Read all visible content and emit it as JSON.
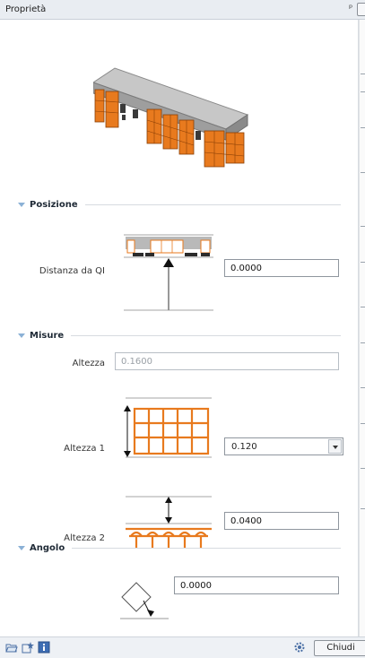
{
  "window": {
    "title": "Proprietà",
    "pin_glyph": "ᵖ"
  },
  "sections": {
    "posizione": {
      "label": "Posizione"
    },
    "misure": {
      "label": "Misure"
    },
    "angolo": {
      "label": "Angolo"
    }
  },
  "fields": {
    "distanza": {
      "label": "Distanza da QI",
      "value": "0.0000"
    },
    "altezza": {
      "label": "Altezza",
      "value": "0.1600"
    },
    "altezza1": {
      "label": "Altezza 1",
      "value": "0.120"
    },
    "altezza2": {
      "label": "Altezza 2",
      "value": "0.0400"
    },
    "angolo": {
      "value": "0.0000"
    }
  },
  "statusbar": {
    "close_label": "Chiudi"
  },
  "colors": {
    "accent_orange": "#e87a1e",
    "concrete": "#a9a9a9",
    "section_arrow": "#8bb1d6"
  },
  "icons": [
    "folder-open-icon",
    "favorites-icon",
    "info-icon",
    "settings-gear-icon"
  ]
}
